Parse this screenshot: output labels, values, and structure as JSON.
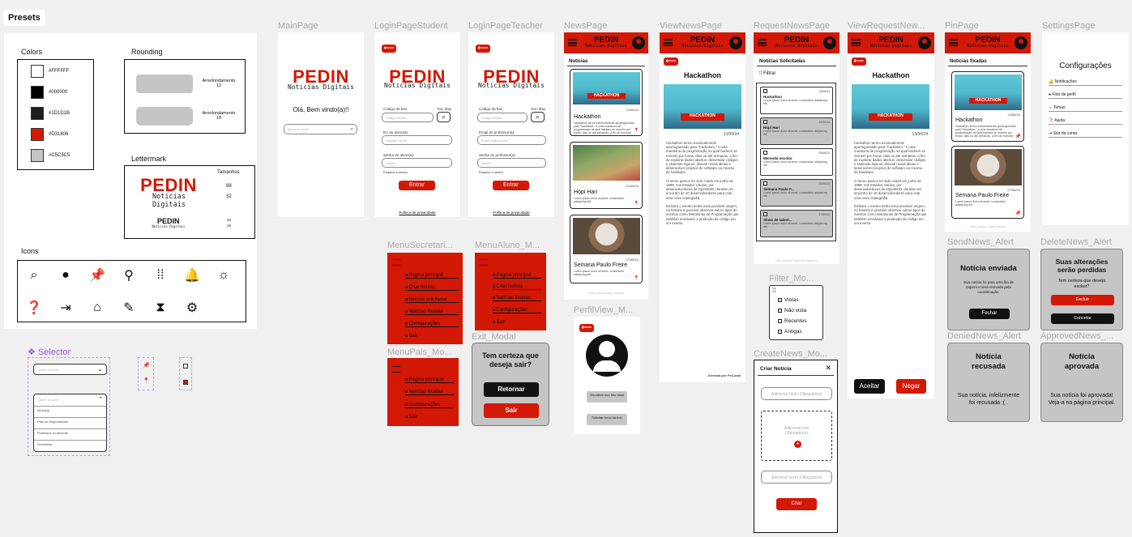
{
  "presets": {
    "title": "Presets",
    "colors_title": "Colors",
    "colors": [
      {
        "hex": "#FFFFFF",
        "swatch": "#ffffff"
      },
      {
        "hex": "#000000",
        "swatch": "#000000"
      },
      {
        "hex": "#1D1D1B",
        "swatch": "#1d1d1b"
      },
      {
        "hex": "#D31806",
        "swatch": "#d31806"
      },
      {
        "hex": "#C5C5C5",
        "swatch": "#c5c5c5"
      }
    ],
    "rounding_title": "Rounding",
    "rounding": [
      {
        "label": "Arredondamento",
        "value": "12"
      },
      {
        "label": "Arredondamento",
        "value": "18"
      }
    ],
    "lettermark_title": "Lettermark",
    "lettermark_sizes_title": "Tamanhos",
    "lettermark_sizes": [
      "98",
      "32",
      "40",
      "16"
    ],
    "icons_title": "Icons",
    "icons": [
      "search-icon",
      "account-icon",
      "pin-filled-icon",
      "pin-outline-icon",
      "apps-icon",
      "bell-icon",
      "brightness-icon",
      "help-icon",
      "logout-icon",
      "home-icon",
      "pencil-icon",
      "hourglass-icon",
      "gear-icon"
    ]
  },
  "brand": {
    "name": "PEDIN",
    "tagline": "Noticias Digitais",
    "red": "#D31806"
  },
  "selector": {
    "title": "Selector",
    "placeholder": "Quem é você?",
    "options": [
      "Aluno(a)",
      "Pais ou responsavels",
      "Professor ou docente",
      "Secretaria"
    ]
  },
  "frames": {
    "main": {
      "title": "MainPage",
      "greeting": "Olá, Bem vindo(a)!!",
      "select_placeholder": "Quem é você?"
    },
    "login_student": {
      "title": "LoginPageStudent",
      "code_label": "Código da Esc:",
      "code_placeholder": "Código escola",
      "search_label": "Esc disp",
      "ra_label": "RA do aluno(a):",
      "ra_placeholder": "Número do RA",
      "pass_label": "Senha do aluno(a):",
      "pass_placeholder": "Senha",
      "forgot": "Esqueci a senha",
      "enter": "Entrar",
      "privacy": "Política de privacidade"
    },
    "login_teacher": {
      "title": "LoginPageTeacher",
      "code_label": "Código da Esc:",
      "code_placeholder": "Código escola",
      "search_label": "Esc disp",
      "email_label": "Email do professor(a):",
      "email_placeholder": "Email institucional",
      "pass_label": "Senha do professor(a):",
      "pass_placeholder": "Senha",
      "forgot": "Esqueci a senha",
      "enter": "Entrar",
      "privacy": "Política de privacidade"
    },
    "news": {
      "title": "NewsPage",
      "section": "Notícias",
      "items": [
        {
          "title": "Hackathon",
          "date": "13/06/24",
          "img_label": "HACKATHON"
        },
        {
          "title": "Hopi Hari",
          "date": "12/06/24"
        },
        {
          "title": "Semana Paulo Freire",
          "date": "07/06/24"
        }
      ],
      "footer": "Não possui mais notícias"
    },
    "view_news": {
      "title": "ViewNewsPage",
      "heading": "Hackathon",
      "date": "13/06/24",
      "img_label": "HACKATHON",
      "body1": "Hackathon termo eventualmente aportuguesado para \"hackatom,\" é uma maratona de programação na qual hackers se reúnem por horas, dias ou até semanas, a fim de explorar dados abertos, desvendar códigos e sistemas lógicos, discutir novas ideias e desenvolver projetos de software ou mesmo de hardware.",
      "body2": "O termo parece ter sido criado em junho de 1999, nos Estados Unidos, por desenvolvedores de OpenBSD, durante um encontro de 10 desenvolvedores para criar uma nova criptografia.",
      "body3": "Embora o evento tenha essa provável origem, na história é possível observar outros tipos de eventos como Maratonas de Programação que também envolviam a produção de código em um evento.",
      "sent_by": "- Enviada por PeCosta"
    },
    "request_news": {
      "title": "RequestNewsPage",
      "section": "Notícias Solicitadas",
      "filter": "Filtrar",
      "items": [
        {
          "title": "Hackathon",
          "date": "13/06/24"
        },
        {
          "title": "Hopi Hari",
          "date": "12/06/24"
        },
        {
          "title": "Merenda escolar",
          "date": "09/06/24"
        },
        {
          "title": "Semana Paulo F...",
          "date": "05/06/24"
        },
        {
          "title": "Show de talent...",
          "date": "27/05/24"
        }
      ],
      "item_text": "Lorem ipsum dolor sit amet, consectetur adipiscing elit.",
      "footer": "Não possui mais solicitações"
    },
    "view_request": {
      "title": "ViewRequestNew...",
      "heading": "Hackathon",
      "date": "13/06/24",
      "accept": "Aceitar",
      "deny": "Negar"
    },
    "pin": {
      "title": "PinPage",
      "section": "Notícias fixadas",
      "items": [
        {
          "title": "Hackathon",
          "date": "13/06/24"
        },
        {
          "title": "Semana Paulo Freire",
          "date": "07/06/24"
        }
      ],
      "footer": "Não possui mais fixadas"
    },
    "settings": {
      "title": "SettingsPage",
      "heading": "Configurações",
      "items": [
        "Notificações",
        "Foto de perfil",
        "Temas",
        "Ajuda",
        "Sair da conta"
      ]
    },
    "menu_secretaria": {
      "title": "MenuSecretari...",
      "items": [
        "Página principal",
        "Criar notícia",
        "Notícias solicitadas",
        "Notícias fixadas",
        "Configurações",
        "Sair"
      ]
    },
    "menu_aluno": {
      "title": "MenuAluno_M...",
      "items": [
        "Página principal",
        "Criar notícia",
        "Notícias fixadas",
        "Configurações",
        "Sair"
      ]
    },
    "menu_pais": {
      "title": "MenuPais_Mo...",
      "items": [
        "Página principal",
        "Notícias fixadas",
        "Configurações",
        "Sair"
      ]
    },
    "exit_modal": {
      "title": "Exit_Modal",
      "question": "Tem certeza que deseja sair?",
      "back": "Retornar",
      "exit": "Sair"
    },
    "profile": {
      "title": "PerfilView_M...",
      "btn1": "Visualizar sua foto atual",
      "btn2": "Solicitar troca da foto"
    },
    "filter_modal": {
      "title": "Filter_Mo...",
      "options": [
        "Vistas",
        "Não vista",
        "Recentes",
        "Antigas"
      ]
    },
    "create_news": {
      "title": "CreateNews_Mo...",
      "heading": "Criar Notícia",
      "title_placeholder": "Adicionar título (Obrigatório)",
      "photo_placeholder": "Adicionar foto (Obrigatório)",
      "text_placeholder": "Adicionar texto (Obrigatório)",
      "create": "Criar"
    },
    "send_alert": {
      "title": "SendNews_Alert",
      "heading": "Notícia enviada",
      "text": "Sua notícia foi para uma fila de espera e será revisada pela coordenação.",
      "close": "Fechar"
    },
    "delete_alert": {
      "title": "DeleteNews_Alert",
      "heading": "Suas alterações serão perdidas",
      "text": "Tem certeza que deseja excluir?",
      "delete": "Excluir",
      "cancel": "Cancelar"
    },
    "denied_alert": {
      "title": "DeniedNews_Alert",
      "heading": "Notícia recusada",
      "text": "Sua notícia, infelizmente foi recusada ;( ."
    },
    "approved_alert": {
      "title": "ApprovedNews_...",
      "heading": "Notícia aprovada",
      "text": "Sua notícia foi aprovada! Veja-a na página principal."
    }
  }
}
